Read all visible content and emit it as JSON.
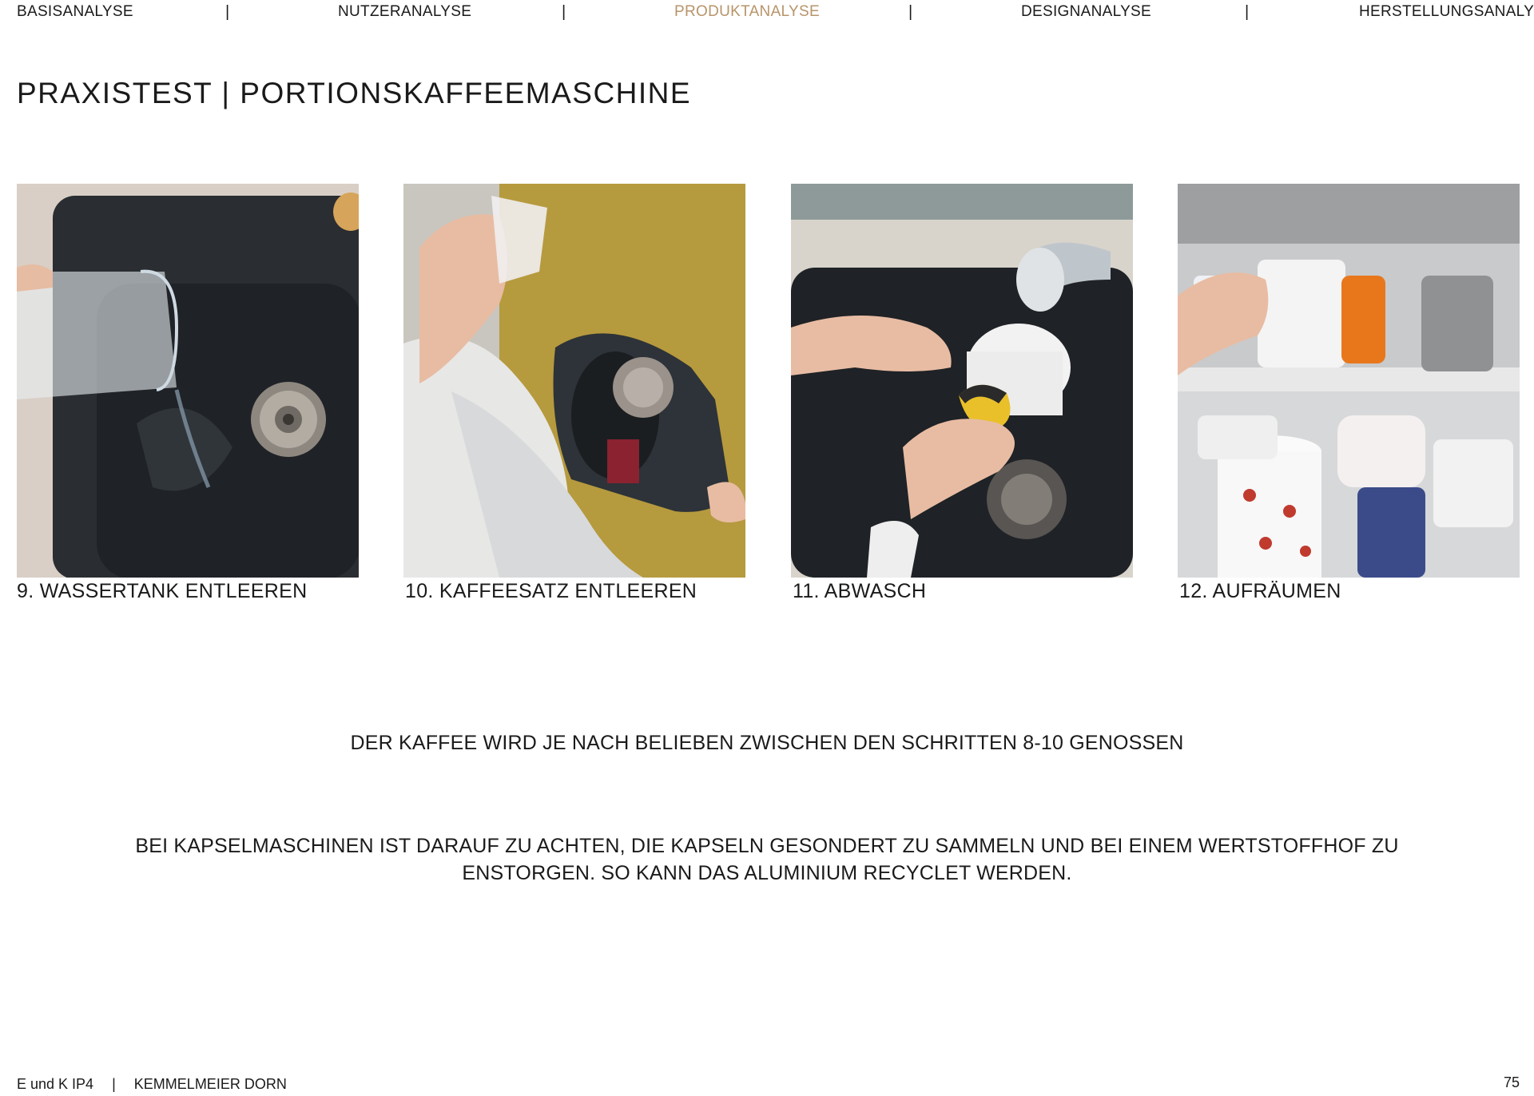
{
  "nav": {
    "items": [
      "BASISANALYSE",
      "NUTZERANALYSE",
      "PRODUKTANALYSE",
      "DESIGNANALYSE",
      "HERSTELLUNGSANALYSE"
    ],
    "separator": "|",
    "active_color": "#b8946a"
  },
  "title": "PRAXISTEST | PORTIONSKAFFEEMASCHINE",
  "steps": [
    {
      "caption": "9. WASSERTANK ENTLEEREN"
    },
    {
      "caption": "10. KAFFEESATZ ENTLEEREN"
    },
    {
      "caption": "11. ABWASCH"
    },
    {
      "caption": "12. AUFRÄUMEN"
    }
  ],
  "notes": {
    "enjoy": "DER KAFFEE WIRD JE NACH BELIEBEN ZWISCHEN DEN SCHRITTEN 8-10 GENOSSEN",
    "recycle_line1": "BEI KAPSELMASCHINEN IST DARAUF ZU ACHTEN, DIE KAPSELN GESONDERT ZU SAMMELN UND BEI EINEM WERTSTOFFHOF ZU",
    "recycle_line2": "ENSTORGEN. SO KANN DAS ALUMINIUM RECYCLET WERDEN."
  },
  "footer": {
    "course": "E und K IP4",
    "separator": "|",
    "authors": "KEMMELMEIER  DORN",
    "page": "75"
  }
}
